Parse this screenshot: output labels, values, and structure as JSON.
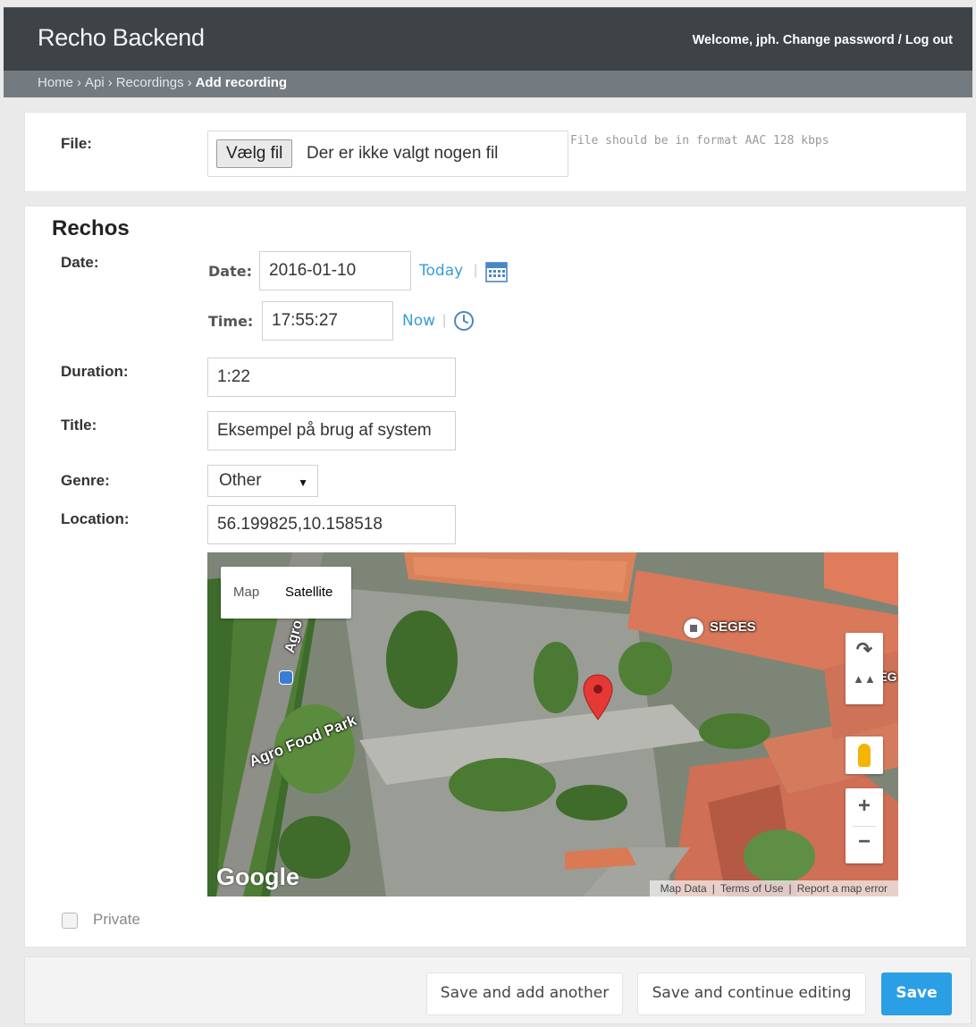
{
  "header": {
    "brand": "Recho Backend",
    "welcome": "Welcome, ",
    "username": "jph",
    "dot": ". ",
    "change_password": "Change password",
    "slash": " / ",
    "logout": "Log out"
  },
  "breadcrumbs": {
    "home": "Home",
    "api": "Api",
    "recordings": "Recordings",
    "current": "Add recording",
    "separator": "›"
  },
  "file": {
    "label": "File:",
    "button_label": "Vælg fil",
    "status": "Der er ikke valgt nogen fil",
    "help": "File should be in format AAC 128 kbps"
  },
  "rechos": {
    "section_title": "Rechos",
    "date_label": "Date:",
    "date_sublabel": "Date:",
    "date_value": "2016-01-10",
    "today_link": "Today",
    "time_sublabel": "Time:",
    "time_value": "17:55:27",
    "now_link": "Now",
    "pipe": "|",
    "duration_label": "Duration:",
    "duration_value": "1:22",
    "title_label": "Title:",
    "title_value": "Eksempel på brug af system",
    "genre_label": "Genre:",
    "genre_value": "Other",
    "location_label": "Location:",
    "location_value": "56.199825,10.158518",
    "private_label": "Private",
    "private_checked": false
  },
  "map": {
    "type_map": "Map",
    "type_satellite": "Satellite",
    "poi_label": "SEGES",
    "poi_label_edge": "SEG",
    "road_label": "Agro Food Park",
    "road_label_vertical": "Agro",
    "google_logo": "Google",
    "footer_map_data": "Map Data",
    "footer_terms": "Terms of Use",
    "footer_report": "Report a map error",
    "zoom_in": "+",
    "zoom_out": "−",
    "marker_color": "#e53935"
  },
  "actions": {
    "save_add_another": "Save and add another",
    "save_continue": "Save and continue editing",
    "save": "Save"
  },
  "colors": {
    "header_bg": "#3e4347",
    "breadcrumb_bg": "#737a80",
    "link": "#3a9bd5",
    "save_button": "#2b9fe6"
  }
}
